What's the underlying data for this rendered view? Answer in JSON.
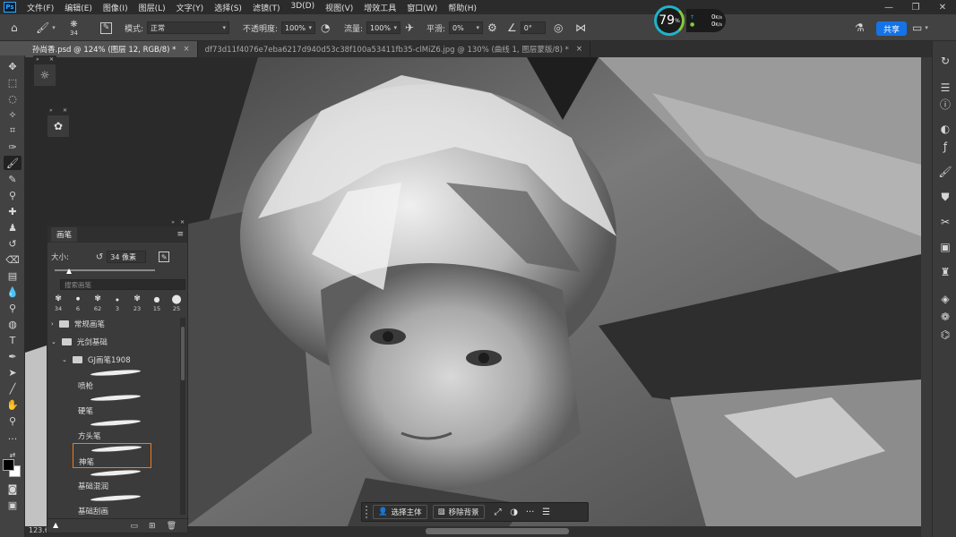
{
  "app": {
    "logo": "Ps",
    "menu": [
      "文件(F)",
      "编辑(E)",
      "图像(I)",
      "图层(L)",
      "文字(Y)",
      "选择(S)",
      "滤镜(T)",
      "3D(D)",
      "视图(V)",
      "增效工具",
      "窗口(W)",
      "帮助(H)"
    ],
    "window_controls": [
      "—",
      "❐",
      "✕"
    ]
  },
  "perf": {
    "percent": "79",
    "unit": "%",
    "up": "0",
    "down": "0",
    "rate_unit": "K/s"
  },
  "options": {
    "brush_size": "34",
    "mode_label": "模式:",
    "mode_value": "正常",
    "opacity_label": "不透明度:",
    "opacity_value": "100%",
    "flow_label": "流量:",
    "flow_value": "100%",
    "smooth_label": "平滑:",
    "smooth_value": "0%",
    "angle_value": "0°",
    "share_label": "共享"
  },
  "tabs": [
    {
      "label": "孙尚香.psd @ 124% (图层 12, RGB/8) *",
      "active": true
    },
    {
      "label": "df73d11f4076e7eba6217d940d53c38f100a53411fb35-clMiZ6.jpg @ 130% (曲线 1, 图层蒙版/8) *",
      "active": false
    }
  ],
  "status": {
    "zoom": "123.6"
  },
  "brush_panel": {
    "tab": "画笔",
    "size_label": "大小:",
    "size_value": "34 像素",
    "search_placeholder": "搜索画笔",
    "presets": [
      "34",
      "6",
      "62",
      "3",
      "23",
      "15",
      "25"
    ],
    "groups": [
      {
        "label": "常规画笔"
      },
      {
        "label": "光剑基础"
      },
      {
        "label": "GJ画笔1908"
      }
    ],
    "brushes": [
      "喷枪",
      "硬笔",
      "方头笔",
      "神笔",
      "基础混润",
      "基础刮画"
    ],
    "selected_brush": "神笔"
  },
  "taskbar": {
    "select_subject": "选择主体",
    "remove_bg": "移除背景",
    "more": "···"
  }
}
